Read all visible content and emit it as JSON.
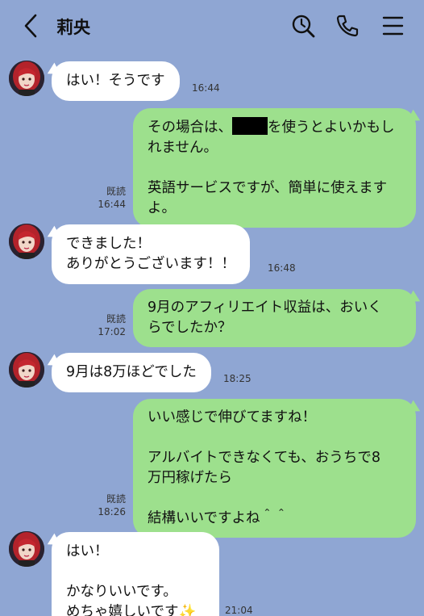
{
  "header": {
    "back_icon": "chevron-left-icon",
    "contact_name": "莉央",
    "search_icon": "search-icon",
    "call_icon": "phone-icon",
    "menu_icon": "menu-icon"
  },
  "messages": [
    {
      "dir": "in",
      "text": "はい！そうです",
      "time": "16:44"
    },
    {
      "dir": "out",
      "text_before_redaction": "その場合は、",
      "text_after_redaction": "を使うとよいかもし\nれません。\n\n英語サービスですが、簡単に使えます\nよ。",
      "read": "既読",
      "time": "16:44"
    },
    {
      "dir": "in",
      "text": "できました！\nありがとうございます！！",
      "time": "16:48"
    },
    {
      "dir": "out",
      "text": "9月のアフィリエイト収益は、おいく\nらでしたか？",
      "read": "既読",
      "time": "17:02"
    },
    {
      "dir": "in",
      "text": "9月は8万ほどでした",
      "time": "18:25"
    },
    {
      "dir": "out",
      "text": "いい感じで伸びてますね！\n\nアルバイトできなくても、おうちで8\n万円稼げたら\n\n結構いいですよね＾＾",
      "read": "既読",
      "time": "18:26"
    },
    {
      "dir": "in",
      "text": "はい！\n\nかなりいいです。\nめちゃ嬉しいです✨",
      "time": "21:04"
    }
  ],
  "colors": {
    "background": "#8fa6d3",
    "incoming_bubble": "#ffffff",
    "outgoing_bubble": "#9de08d",
    "avatar_hair": "#b3232b"
  }
}
